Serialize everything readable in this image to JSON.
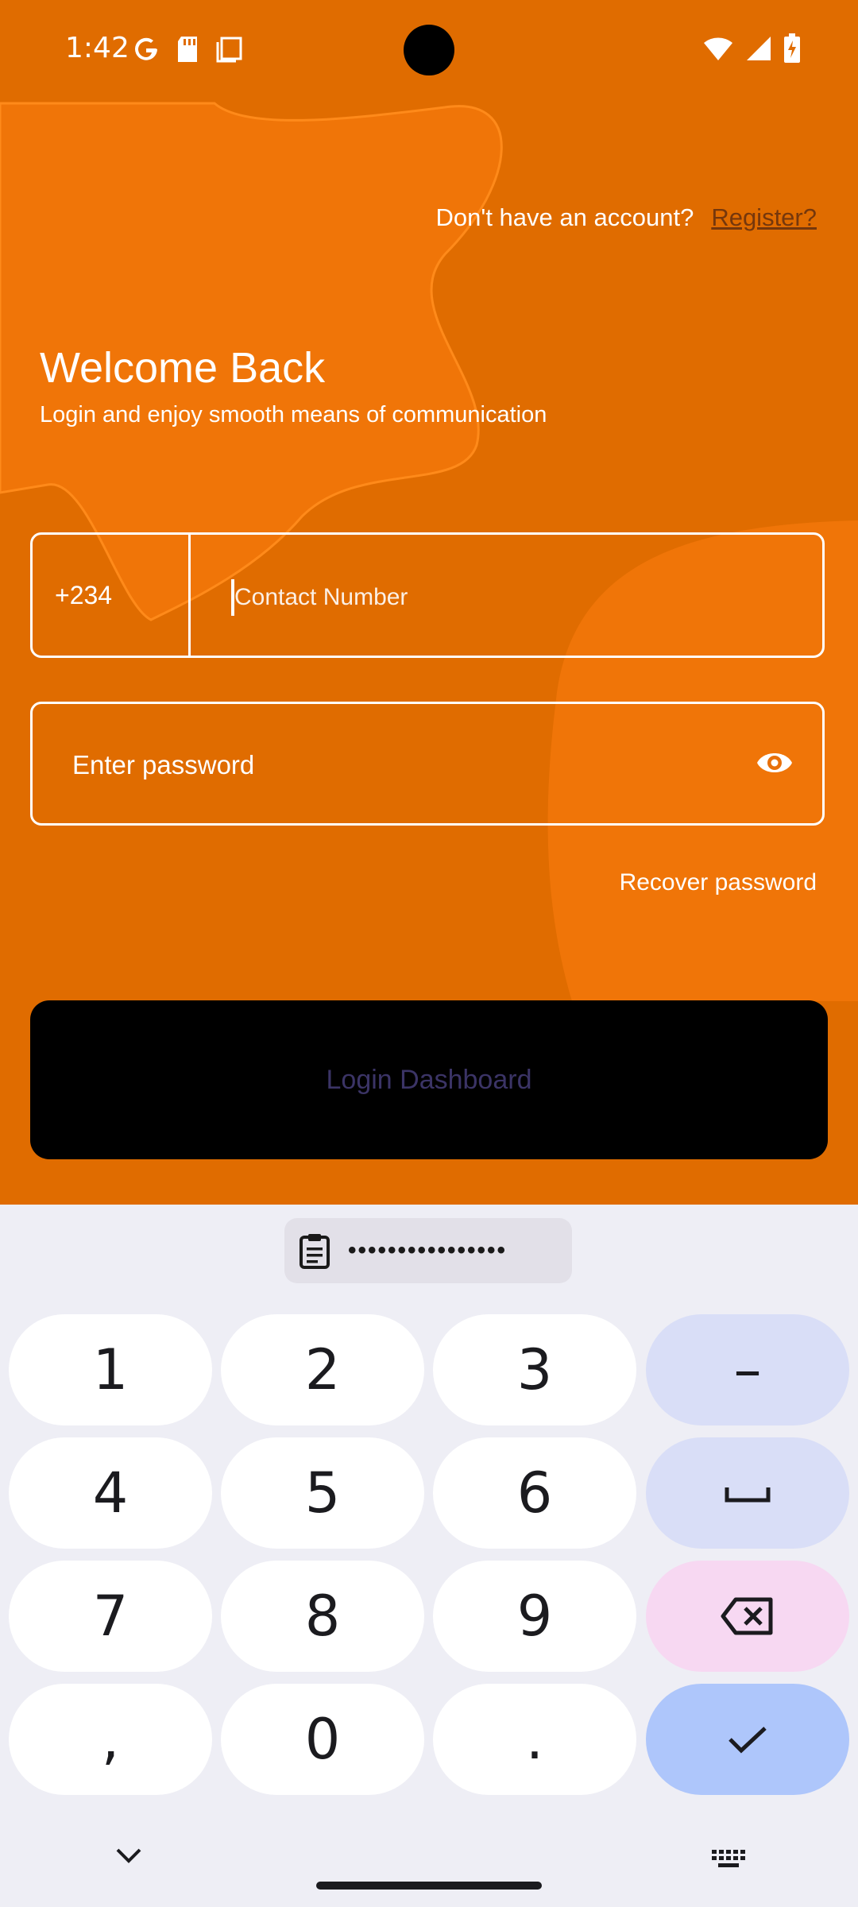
{
  "status_bar": {
    "time": "1:42"
  },
  "auth": {
    "no_account_text": "Don't have an account?",
    "register_link": "Register?",
    "title": "Welcome Back",
    "subtitle": "Login and enjoy smooth means of communication",
    "country_code": "+234",
    "contact_placeholder": "Contact Number",
    "password_placeholder": "Enter password",
    "recover_link": "Recover password",
    "login_button": "Login Dashboard"
  },
  "keyboard": {
    "clipboard_preview": "••••••••••••••••",
    "keys": [
      "1",
      "2",
      "3",
      "–",
      "4",
      "5",
      "6",
      "␣",
      "7",
      "8",
      "9",
      "⌫",
      ",",
      "0",
      ".",
      "✓"
    ]
  },
  "colors": {
    "background": "#e06c00",
    "blob": "#f07508",
    "button": "#000000",
    "keyboard_bg": "#eeeef5"
  }
}
